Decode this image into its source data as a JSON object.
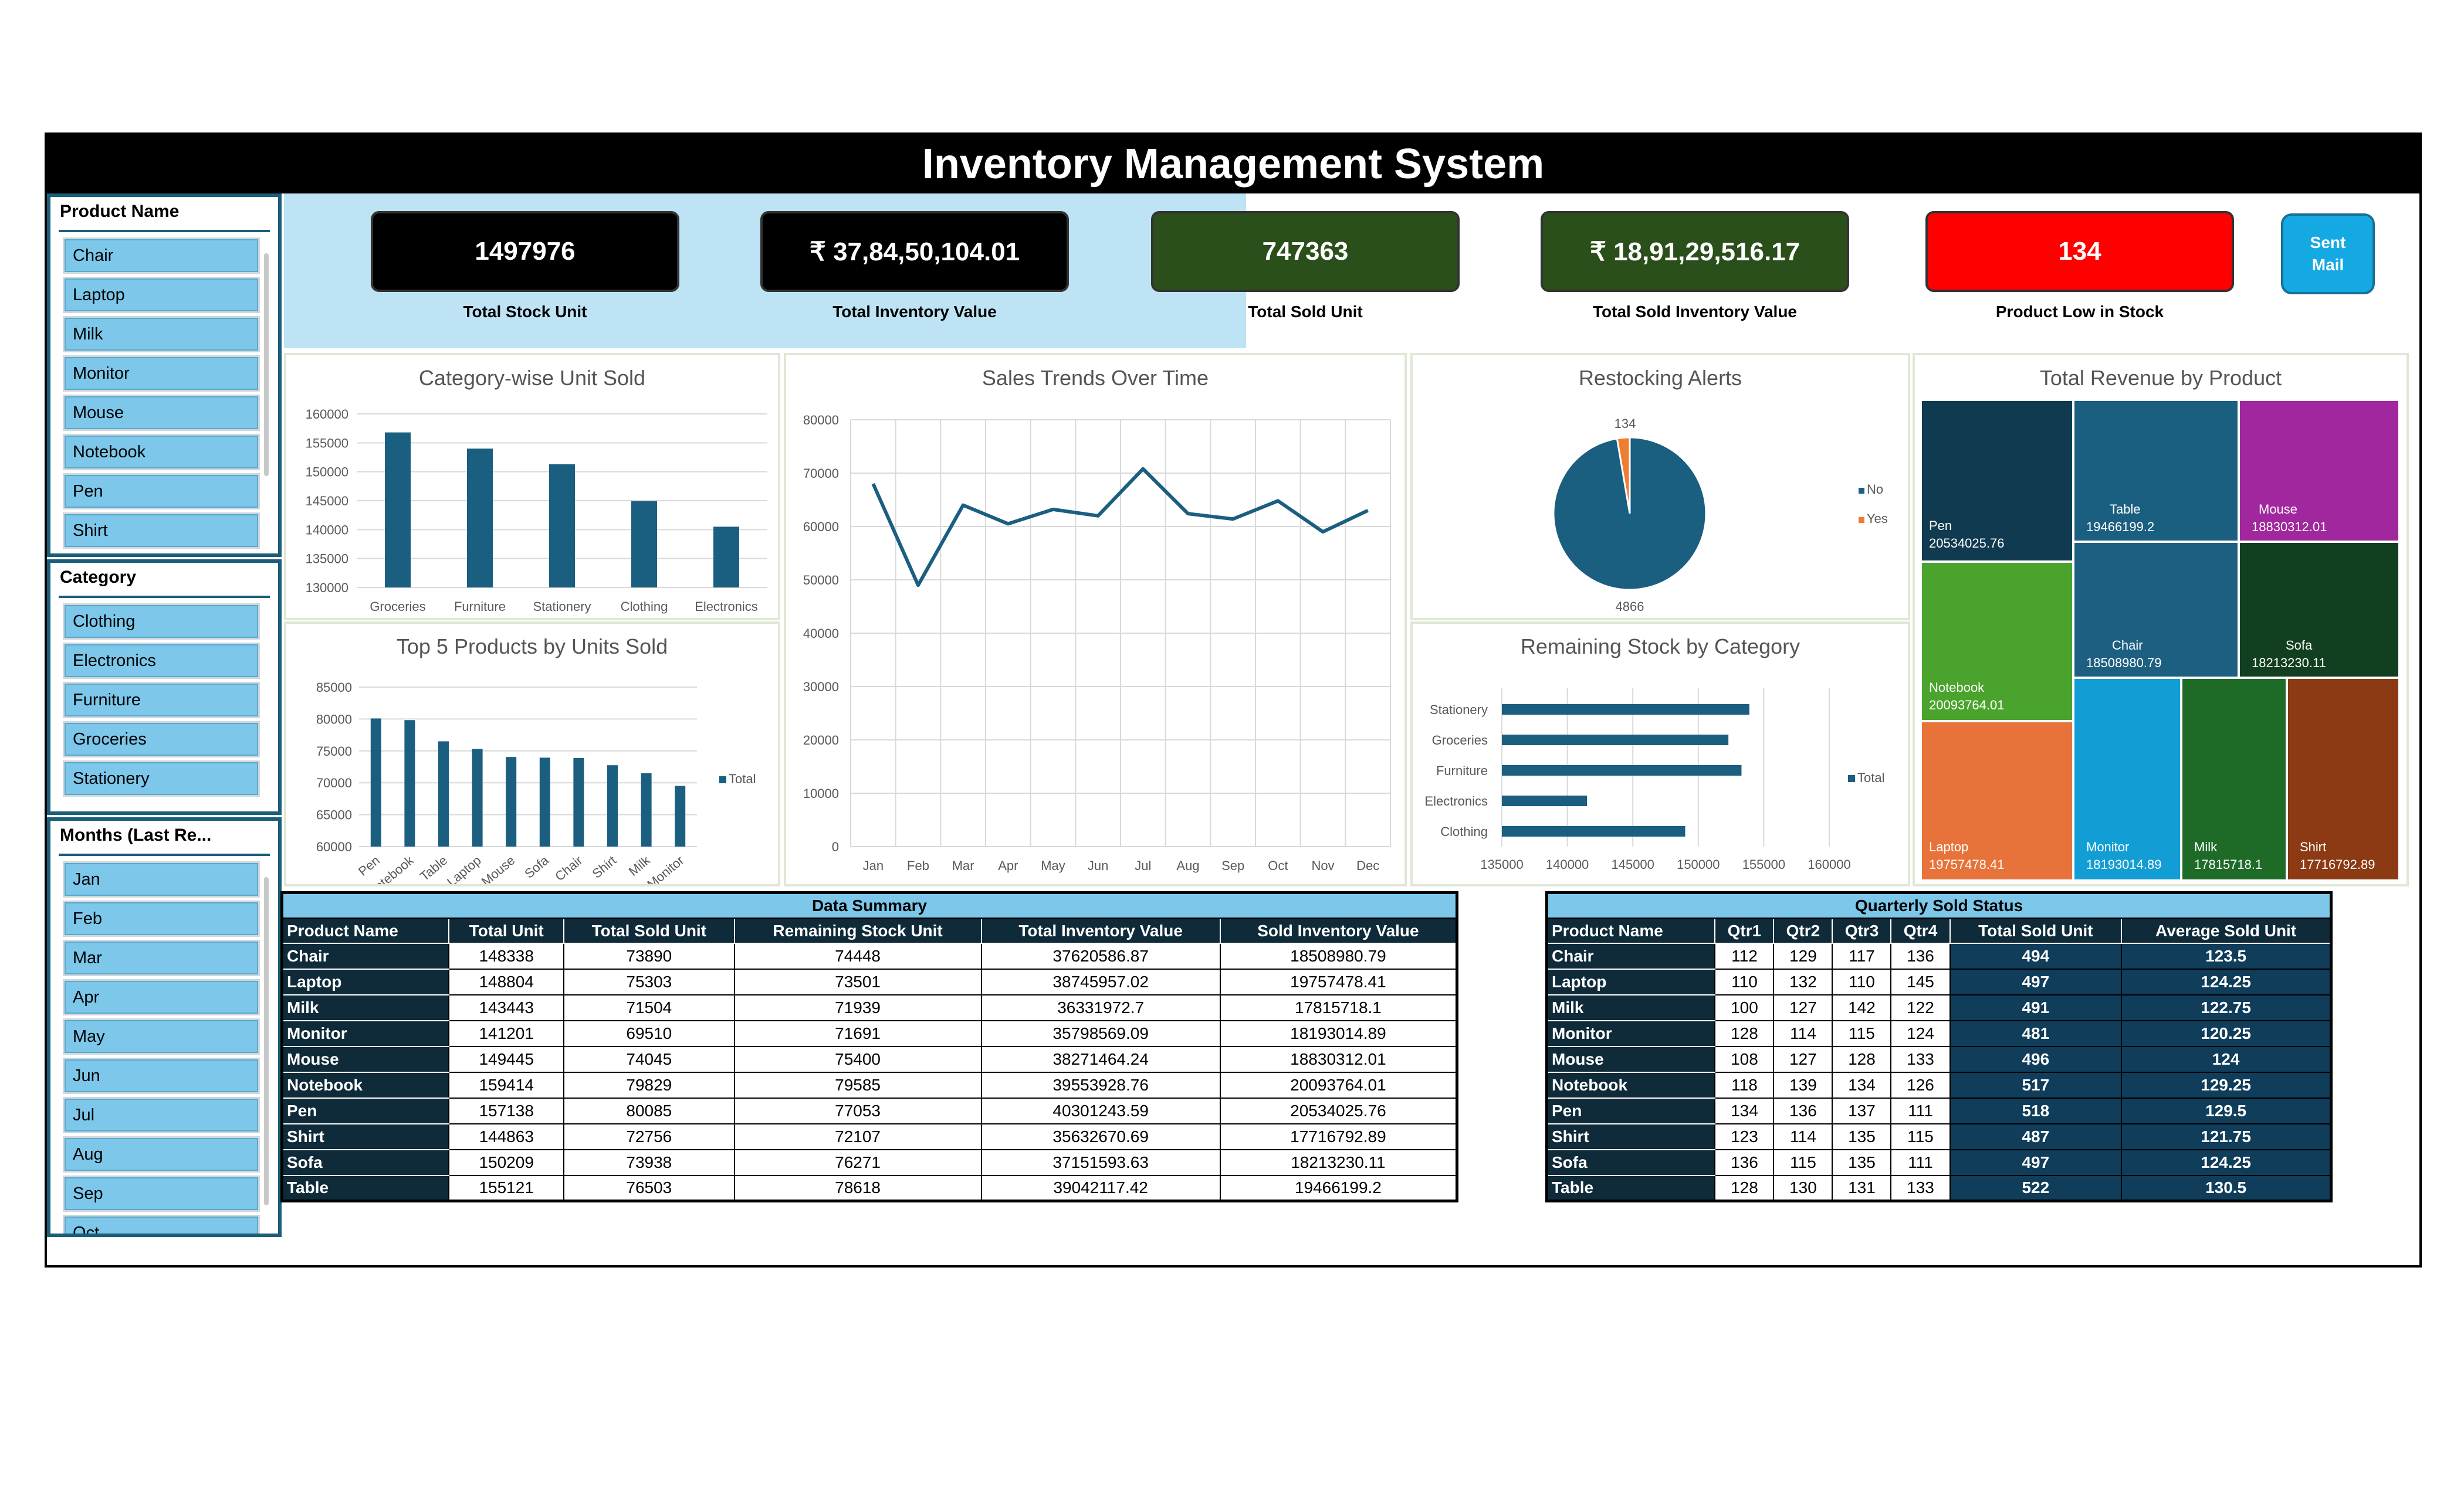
{
  "title": "Inventory Management System",
  "slicers": {
    "product": {
      "title": "Product Name",
      "items": [
        "Chair",
        "Laptop",
        "Milk",
        "Monitor",
        "Mouse",
        "Notebook",
        "Pen",
        "Shirt"
      ]
    },
    "category": {
      "title": "Category",
      "items": [
        "Clothing",
        "Electronics",
        "Furniture",
        "Groceries",
        "Stationery"
      ]
    },
    "months": {
      "title": "Months (Last Re...",
      "items": [
        "Jan",
        "Feb",
        "Mar",
        "Apr",
        "May",
        "Jun",
        "Jul",
        "Aug",
        "Sep",
        "Oct"
      ]
    }
  },
  "kpis": [
    {
      "value": "1497976",
      "label": "Total Stock Unit",
      "color": "#000000"
    },
    {
      "value": "₹ 37,84,50,104.01",
      "label": "Total Inventory Value",
      "color": "#000000"
    },
    {
      "value": "747363",
      "label": "Total Sold Unit",
      "color": "#2b4f1b"
    },
    {
      "value": "₹ 18,91,29,516.17",
      "label": "Total Sold Inventory Value",
      "color": "#2b4f1b"
    },
    {
      "value": "134",
      "label": "Product Low in Stock",
      "color": "#ff0000"
    }
  ],
  "send_button": {
    "line1": "Sent",
    "line2": "Mail"
  },
  "charts": {
    "category_sold": {
      "title": "Category-wise Unit Sold"
    },
    "top5": {
      "title": "Top 5 Products by Units Sold",
      "legend": "Total"
    },
    "sales_trend": {
      "title": "Sales Trends Over Time"
    },
    "restock": {
      "title": "Restocking Alerts",
      "legend_no": "No",
      "legend_yes": "Yes"
    },
    "remaining": {
      "title": "Remaining Stock by Category",
      "legend": "Total"
    },
    "revenue": {
      "title": "Total Revenue by Product"
    }
  },
  "chart_data": [
    {
      "type": "bar",
      "title": "Category-wise Unit Sold",
      "categories": [
        "Groceries",
        "Furniture",
        "Stationery",
        "Clothing",
        "Electronics"
      ],
      "values": [
        156800,
        154000,
        151300,
        144900,
        140500
      ],
      "ylim": [
        130000,
        160000
      ],
      "yticks": [
        130000,
        135000,
        140000,
        145000,
        150000,
        155000,
        160000
      ]
    },
    {
      "type": "bar",
      "title": "Top 5 Products by Units Sold",
      "categories": [
        "Pen",
        "Notebook",
        "Table",
        "Laptop",
        "Mouse",
        "Sofa",
        "Chair",
        "Shirt",
        "Milk",
        "Monitor"
      ],
      "series": [
        {
          "name": "Total",
          "values": [
            80085,
            79829,
            76503,
            75303,
            74045,
            73938,
            73890,
            72756,
            71504,
            69510
          ]
        }
      ],
      "ylim": [
        60000,
        85000
      ],
      "yticks": [
        60000,
        65000,
        70000,
        75000,
        80000,
        85000
      ]
    },
    {
      "type": "line",
      "title": "Sales Trends Over Time",
      "categories": [
        "Jan",
        "Feb",
        "Mar",
        "Apr",
        "May",
        "Jun",
        "Jul",
        "Aug",
        "Sep",
        "Oct",
        "Nov",
        "Dec"
      ],
      "values": [
        68000,
        49000,
        64000,
        60500,
        63200,
        62000,
        70800,
        62400,
        61400,
        64800,
        59000,
        63000
      ],
      "ylim": [
        0,
        80000
      ],
      "yticks": [
        0,
        10000,
        20000,
        30000,
        40000,
        50000,
        60000,
        70000,
        80000
      ]
    },
    {
      "type": "pie",
      "title": "Restocking Alerts",
      "labels": [
        "No",
        "Yes"
      ],
      "values": [
        4866,
        134
      ],
      "colors": [
        "#1a5e80",
        "#ed7d31"
      ]
    },
    {
      "type": "bar",
      "title": "Remaining Stock by Category",
      "orientation": "horizontal",
      "categories": [
        "Stationery",
        "Groceries",
        "Furniture",
        "Electronics",
        "Clothing"
      ],
      "series": [
        {
          "name": "Total",
          "values": [
            153900,
            152300,
            153300,
            141500,
            149000
          ]
        }
      ],
      "xlim": [
        135000,
        160000
      ],
      "xticks": [
        135000,
        140000,
        145000,
        150000,
        155000,
        160000
      ]
    },
    {
      "type": "heatmap",
      "subtype": "treemap",
      "title": "Total Revenue by Product",
      "items": [
        {
          "name": "Pen",
          "value": "20534025.76",
          "color": "#0f3a4f"
        },
        {
          "name": "Table",
          "value": "19466199.2",
          "color": "#1a5e80"
        },
        {
          "name": "Mouse",
          "value": "18830312.01",
          "color": "#a0279d"
        },
        {
          "name": "Notebook",
          "value": "20093764.01",
          "color": "#4aa32d"
        },
        {
          "name": "Chair",
          "value": "18508980.79",
          "color": "#1d5f80"
        },
        {
          "name": "Sofa",
          "value": "18213230.11",
          "color": "#123f20"
        },
        {
          "name": "Laptop",
          "value": "19757478.41",
          "color": "#e8733a"
        },
        {
          "name": "Monitor",
          "value": "18193014.89",
          "color": "#129ed4"
        },
        {
          "name": "Milk",
          "value": "17815718.1",
          "color": "#1d6b27"
        },
        {
          "name": "Shirt",
          "value": "17716792.89",
          "color": "#8b3a13"
        }
      ]
    }
  ],
  "data_summary": {
    "caption": "Data Summary",
    "headers": [
      "Product Name",
      "Total Unit",
      "Total Sold Unit",
      "Remaining Stock Unit",
      "Total Inventory Value",
      "Sold Inventory Value"
    ],
    "rows": [
      [
        "Chair",
        "148338",
        "73890",
        "74448",
        "37620586.87",
        "18508980.79"
      ],
      [
        "Laptop",
        "148804",
        "75303",
        "73501",
        "38745957.02",
        "19757478.41"
      ],
      [
        "Milk",
        "143443",
        "71504",
        "71939",
        "36331972.7",
        "17815718.1"
      ],
      [
        "Monitor",
        "141201",
        "69510",
        "71691",
        "35798569.09",
        "18193014.89"
      ],
      [
        "Mouse",
        "149445",
        "74045",
        "75400",
        "38271464.24",
        "18830312.01"
      ],
      [
        "Notebook",
        "159414",
        "79829",
        "79585",
        "39553928.76",
        "20093764.01"
      ],
      [
        "Pen",
        "157138",
        "80085",
        "77053",
        "40301243.59",
        "20534025.76"
      ],
      [
        "Shirt",
        "144863",
        "72756",
        "72107",
        "35632670.69",
        "17716792.89"
      ],
      [
        "Sofa",
        "150209",
        "73938",
        "76271",
        "37151593.63",
        "18213230.11"
      ],
      [
        "Table",
        "155121",
        "76503",
        "78618",
        "39042117.42",
        "19466199.2"
      ]
    ]
  },
  "quarterly": {
    "caption": "Quarterly Sold Status",
    "headers": [
      "Product Name",
      "Qtr1",
      "Qtr2",
      "Qtr3",
      "Qtr4",
      "Total Sold Unit",
      "Average Sold Unit"
    ],
    "rows": [
      [
        "Chair",
        "112",
        "129",
        "117",
        "136",
        "494",
        "123.5"
      ],
      [
        "Laptop",
        "110",
        "132",
        "110",
        "145",
        "497",
        "124.25"
      ],
      [
        "Milk",
        "100",
        "127",
        "142",
        "122",
        "491",
        "122.75"
      ],
      [
        "Monitor",
        "128",
        "114",
        "115",
        "124",
        "481",
        "120.25"
      ],
      [
        "Mouse",
        "108",
        "127",
        "128",
        "133",
        "496",
        "124"
      ],
      [
        "Notebook",
        "118",
        "139",
        "134",
        "126",
        "517",
        "129.25"
      ],
      [
        "Pen",
        "134",
        "136",
        "137",
        "111",
        "518",
        "129.5"
      ],
      [
        "Shirt",
        "123",
        "114",
        "135",
        "115",
        "487",
        "121.75"
      ],
      [
        "Sofa",
        "136",
        "115",
        "135",
        "111",
        "497",
        "124.25"
      ],
      [
        "Table",
        "128",
        "130",
        "131",
        "133",
        "522",
        "130.5"
      ]
    ]
  }
}
